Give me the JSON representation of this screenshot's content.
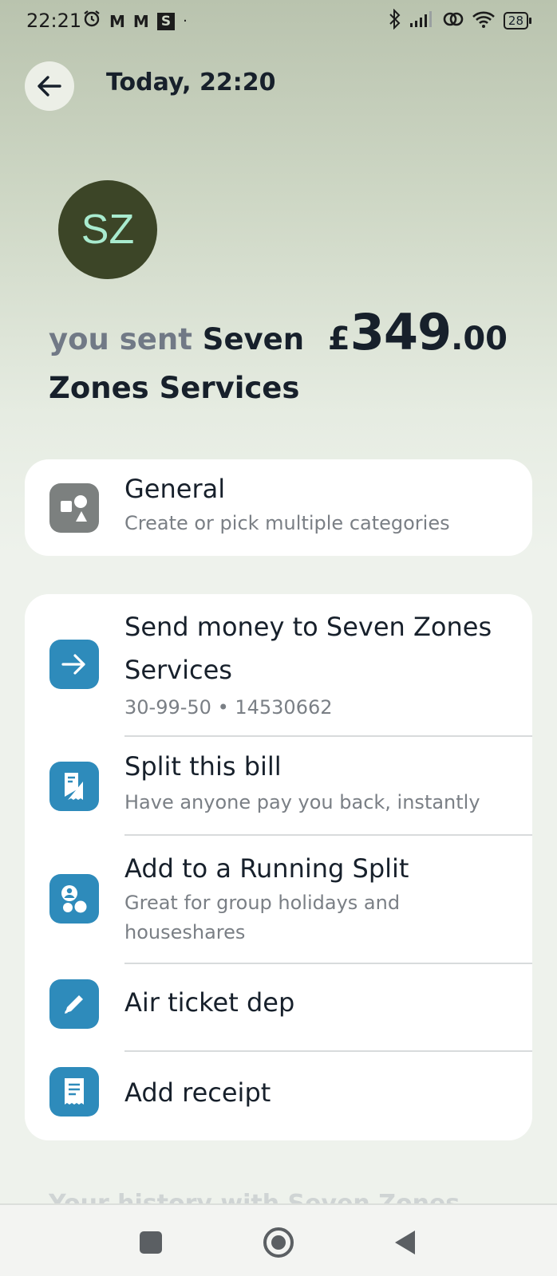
{
  "status_bar": {
    "time": "22:21",
    "left_icons": [
      "alarm-icon",
      "gmail-icon",
      "gmail-icon",
      "s-app-icon",
      "dot"
    ],
    "m_label": "M",
    "s_label": "S",
    "right_icons": [
      "bluetooth-icon",
      "signal-icon",
      "hotspot-icon",
      "wifi-icon",
      "battery-icon"
    ],
    "battery": "28"
  },
  "header": {
    "title": "Today, 22:20"
  },
  "avatar": {
    "initials": "SZ",
    "bg_color": "#3c4527",
    "text_color": "#a9ebcf"
  },
  "transaction": {
    "prefix": "you sent",
    "payee": "Seven Zones Services",
    "currency": "£",
    "amount_major": "349",
    "amount_minor": ".00"
  },
  "category": {
    "title": "General",
    "subtitle": "Create or pick multiple categories",
    "icon": "shapes-icon"
  },
  "actions": [
    {
      "title": "Send money to Seven Zones Services",
      "subtitle": "30-99-50 • 14530662",
      "icon": "arrow-right-icon"
    },
    {
      "title": "Split this bill",
      "subtitle": "Have anyone pay you back, instantly",
      "icon": "split-receipt-icon"
    },
    {
      "title": "Add to a Running Split",
      "subtitle": "Great for group holidays and houseshares",
      "icon": "group-icon"
    },
    {
      "title": "Air ticket dep",
      "subtitle": "",
      "icon": "pencil-icon"
    },
    {
      "title": "Add receipt",
      "subtitle": "",
      "icon": "receipt-icon"
    }
  ],
  "history_heading": "Your history with Seven Zones",
  "colors": {
    "accent_blue": "#2e8bbb",
    "grey_icon": "#7c807f",
    "text_dark": "#17202b"
  }
}
